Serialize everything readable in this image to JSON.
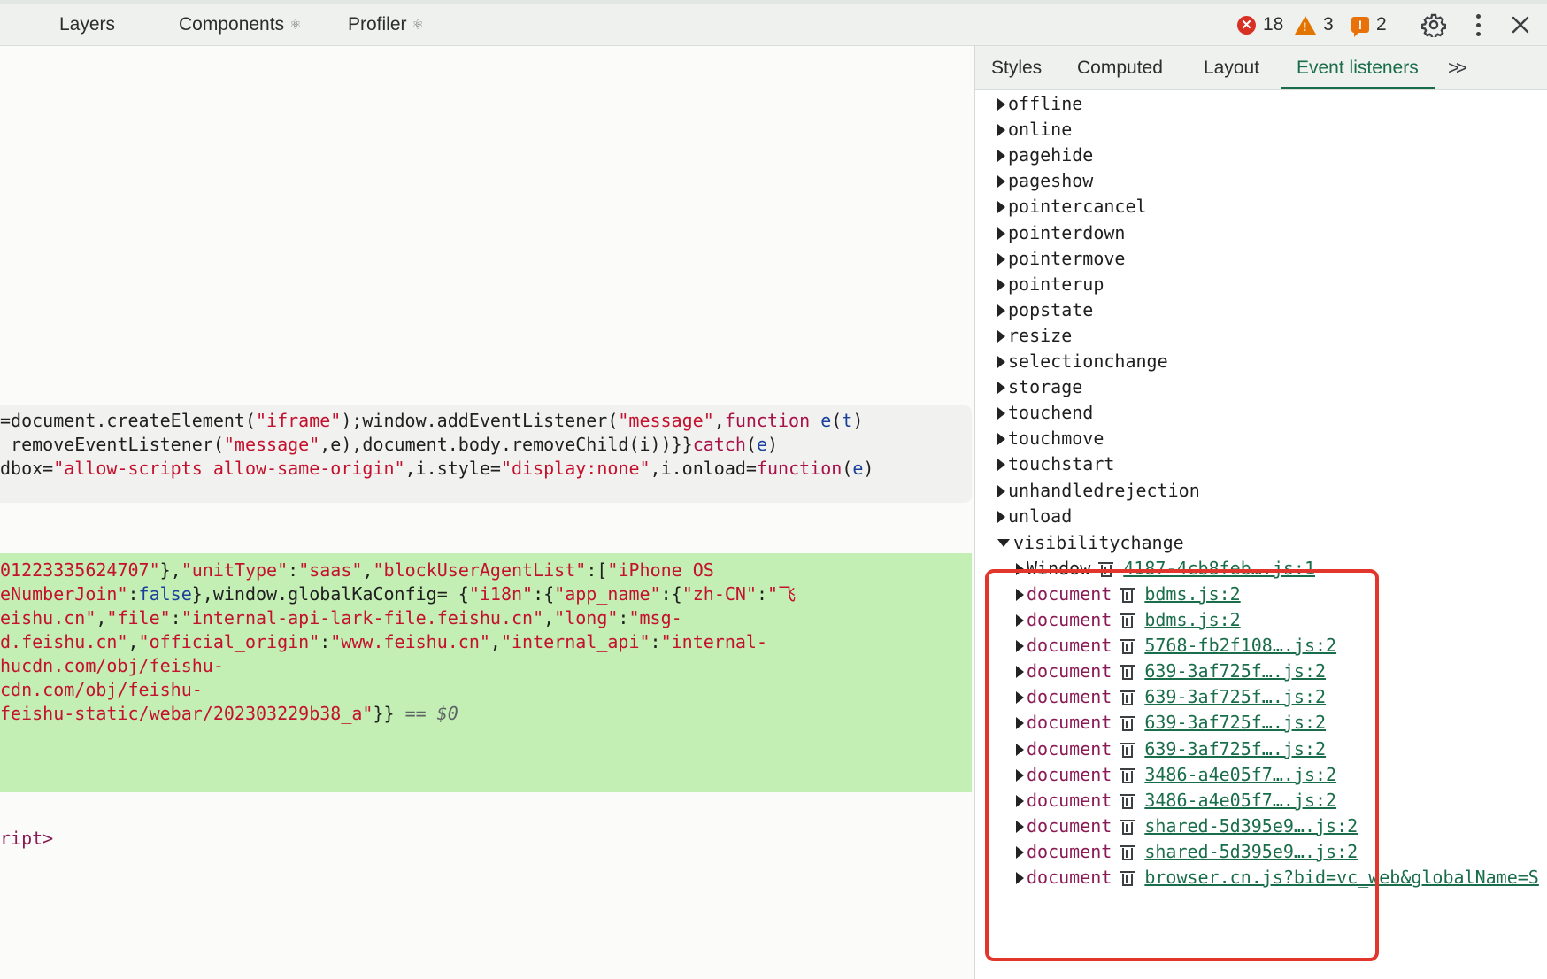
{
  "top_tabs": [
    {
      "label": "Layers",
      "react": ""
    },
    {
      "label": "Components",
      "react": "⚛"
    },
    {
      "label": "Profiler",
      "react": "⚛"
    }
  ],
  "status": {
    "errors": "18",
    "warnings": "3",
    "issues": "2"
  },
  "side_tabs": [
    "Styles",
    "Computed",
    "Layout",
    "Event listeners"
  ],
  "active_side_tab": "Event listeners",
  "code_gray": [
    [
      [
        "plain",
        "=document.createElement("
      ],
      [
        "str",
        "\"iframe\""
      ],
      [
        "plain",
        ");window.addEventListener("
      ],
      [
        "str",
        "\"message\""
      ],
      [
        "plain",
        ","
      ],
      [
        "kw",
        "function"
      ],
      [
        "plain",
        " "
      ],
      [
        "var",
        "e"
      ],
      [
        "plain",
        "("
      ],
      [
        "var",
        "t"
      ],
      [
        "plain",
        ")"
      ]
    ],
    [
      [
        "plain",
        " removeEventListener("
      ],
      [
        "str",
        "\"message\""
      ],
      [
        "plain",
        ",e),document.body.removeChild(i))}}"
      ],
      [
        "kw",
        "catch"
      ],
      [
        "plain",
        "("
      ],
      [
        "var",
        "e"
      ],
      [
        "plain",
        ")"
      ]
    ],
    [
      [
        "plain",
        "dbox="
      ],
      [
        "str",
        "\"allow-scripts allow-same-origin\""
      ],
      [
        "plain",
        ",i.style="
      ],
      [
        "str",
        "\"display:none\""
      ],
      [
        "plain",
        ",i.onload="
      ],
      [
        "kw",
        "function"
      ],
      [
        "plain",
        "("
      ],
      [
        "var",
        "e"
      ],
      [
        "plain",
        ")"
      ]
    ]
  ],
  "code_green": [
    [
      [
        "str",
        "01223335624707\""
      ],
      [
        "plain",
        "},"
      ],
      [
        "str",
        "\"unitType\""
      ],
      [
        "plain",
        ":"
      ],
      [
        "str",
        "\"saas\""
      ],
      [
        "plain",
        ","
      ],
      [
        "str",
        "\"blockUserAgentList\""
      ],
      [
        "plain",
        ":["
      ],
      [
        "str",
        "\"iPhone OS"
      ]
    ],
    [
      [
        "str",
        "eNumberJoin\""
      ],
      [
        "plain",
        ":"
      ],
      [
        "var",
        "false"
      ],
      [
        "plain",
        "},window.globalKaConfig= {"
      ],
      [
        "str",
        "\"i18n\""
      ],
      [
        "plain",
        ":{"
      ],
      [
        "str",
        "\"app_name\""
      ],
      [
        "plain",
        ":{"
      ],
      [
        "str",
        "\"zh-CN\""
      ],
      [
        "plain",
        ":"
      ],
      [
        "str",
        "\"飞"
      ]
    ],
    [
      [
        "str",
        "eishu.cn\""
      ],
      [
        "plain",
        ","
      ],
      [
        "str",
        "\"file\""
      ],
      [
        "plain",
        ":"
      ],
      [
        "str",
        "\"internal-api-lark-file.feishu.cn\""
      ],
      [
        "plain",
        ","
      ],
      [
        "str",
        "\"long\""
      ],
      [
        "plain",
        ":"
      ],
      [
        "str",
        "\"msg-"
      ]
    ],
    [
      [
        "str",
        "d.feishu.cn\""
      ],
      [
        "plain",
        ","
      ],
      [
        "str",
        "\"official_origin\""
      ],
      [
        "plain",
        ":"
      ],
      [
        "str",
        "\"www.feishu.cn\""
      ],
      [
        "plain",
        ","
      ],
      [
        "str",
        "\"internal_api\""
      ],
      [
        "plain",
        ":"
      ],
      [
        "str",
        "\"internal-"
      ]
    ],
    [
      [
        "str",
        "hucdn.com/obj/feishu-"
      ]
    ],
    [
      [
        "str",
        "cdn.com/obj/feishu-"
      ]
    ],
    [
      [
        "str",
        "feishu-static/webar/202303229b38_a\""
      ],
      [
        "plain",
        "}} "
      ],
      [
        "dim",
        "== $0"
      ]
    ]
  ],
  "closing_tag": "ript>",
  "events": [
    "offline",
    "online",
    "pagehide",
    "pageshow",
    "pointercancel",
    "pointerdown",
    "pointermove",
    "pointerup",
    "popstate",
    "resize",
    "selectionchange",
    "storage",
    "touchend",
    "touchmove",
    "touchstart",
    "unhandledrejection",
    "unload"
  ],
  "expanded_event": "visibilitychange",
  "listeners": [
    {
      "target": "Window",
      "source": "4187-4cb8feb….js:1"
    },
    {
      "target": "document",
      "source": "bdms.js:2"
    },
    {
      "target": "document",
      "source": "bdms.js:2"
    },
    {
      "target": "document",
      "source": "5768-fb2f108….js:2"
    },
    {
      "target": "document",
      "source": "639-3af725f….js:2"
    },
    {
      "target": "document",
      "source": "639-3af725f….js:2"
    },
    {
      "target": "document",
      "source": "639-3af725f….js:2"
    },
    {
      "target": "document",
      "source": "639-3af725f….js:2"
    },
    {
      "target": "document",
      "source": "3486-a4e05f7….js:2"
    },
    {
      "target": "document",
      "source": "3486-a4e05f7….js:2"
    },
    {
      "target": "document",
      "source": "shared-5d395e9….js:2"
    },
    {
      "target": "document",
      "source": "shared-5d395e9….js:2"
    },
    {
      "target": "document",
      "source": "browser.cn.js?bid=vc_web&globalName=S"
    }
  ],
  "colors": {
    "highlight": "#e2352c",
    "link": "#1a6d4a",
    "selected_node_bg": "#c3eeb4"
  }
}
